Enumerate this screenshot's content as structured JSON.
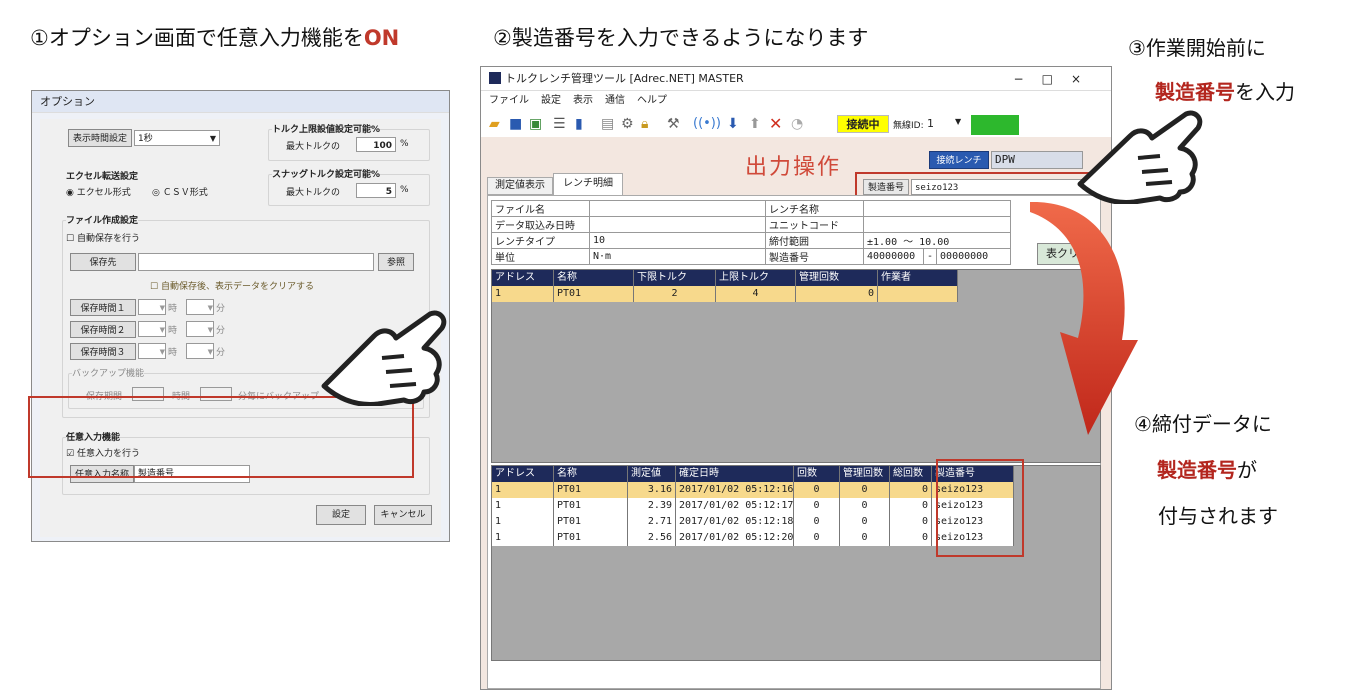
{
  "captions": {
    "c1": "①オプション画面で任意入力機能を",
    "c1_on": "ON",
    "c2": "②製造番号を入力できるようになります",
    "c3": "③作業開始前に",
    "c3b_red": "製造番号",
    "c3b": "を入力",
    "c4": "④締付データに",
    "c4b_red": "製造番号",
    "c4b": "が",
    "c4c": "付与されます"
  },
  "opt": {
    "title": "オプション",
    "disp_time_btn": "表示時間設定",
    "disp_time_val": "1秒",
    "torque_upper": "トルク上限設値設定可能%",
    "max_torque": "最大トルクの",
    "upper_val": "100",
    "pct": "%",
    "excel_title": "エクセル転送設定",
    "excel_opt": "エクセル形式",
    "csv_opt": "ＣＳＶ形式",
    "snag_title": "スナッグトルク設定可能%",
    "snag_val": "5",
    "file_title": "ファイル作成設定",
    "auto_save": "自動保存を行う",
    "save_dest": "保存先",
    "browse": "参照",
    "auto_clear": "自動保存後、表示データをクリアする",
    "save_time1": "保存時間１",
    "save_time2": "保存時間２",
    "save_time3": "保存時間３",
    "hour": "時",
    "min": "分",
    "backup_title": "バックアップ機能",
    "backup_period": "保存期間",
    "backup_hour": "時間",
    "backup_text": "分毎にバックアップ",
    "anyin_title": "任意入力機能",
    "anyin_check": "任意入力を行う",
    "anyin_name_btn": "任意入力名称",
    "anyin_name_val": "製造番号",
    "ok": "設定",
    "cancel": "キャンセル"
  },
  "main": {
    "title": "トルクレンチ管理ツール [Adrec.NET] MASTER",
    "menu": [
      "ファイル",
      "設定",
      "表示",
      "通信",
      "ヘルプ"
    ],
    "status": "接続中",
    "wireless_label": "無線ID:",
    "wireless_val": "1",
    "output_title": "出力操作",
    "conn_wrench_btn": "接続レンチ",
    "conn_wrench_val": "DPW",
    "serial_label": "製造番号",
    "serial_val": "seizo123",
    "tab1": "測定値表示",
    "tab2": "レンチ明細",
    "clear": "表クリア",
    "info": [
      [
        "ファイル名",
        "",
        "レンチ名称",
        ""
      ],
      [
        "データ取込み日時",
        "",
        "ユニットコード",
        ""
      ],
      [
        "レンチタイプ",
        "10",
        "締付範囲",
        "±1.00 ～ 10.00"
      ],
      [
        "単位",
        "N·m",
        "製造番号",
        "40000000",
        "-",
        "00000000"
      ]
    ],
    "grid1_headers": [
      "アドレス",
      "名称",
      "下限トルク",
      "上限トルク",
      "管理回数",
      "作業者"
    ],
    "grid1_rows": [
      [
        "1",
        "PT01",
        "2",
        "4",
        "0",
        ""
      ]
    ],
    "grid2_headers": [
      "アドレス",
      "名称",
      "測定値",
      "確定日時",
      "回数",
      "管理回数",
      "総回数",
      "製造番号"
    ],
    "grid2_rows": [
      [
        "1",
        "PT01",
        "3.16",
        "2017/01/02 05:12:16",
        "0",
        "0",
        "0",
        "seizo123"
      ],
      [
        "1",
        "PT01",
        "2.39",
        "2017/01/02 05:12:17",
        "0",
        "0",
        "0",
        "seizo123"
      ],
      [
        "1",
        "PT01",
        "2.71",
        "2017/01/02 05:12:18",
        "0",
        "0",
        "0",
        "seizo123"
      ],
      [
        "1",
        "PT01",
        "2.56",
        "2017/01/02 05:12:20",
        "0",
        "0",
        "0",
        "seizo123"
      ]
    ]
  },
  "colors": {
    "highlight": "#c0392b",
    "grid_header": "#1e2a5a",
    "status_yellow": "#ffff00",
    "status_green": "#2db82d",
    "row_selected": "#f7d98c"
  }
}
